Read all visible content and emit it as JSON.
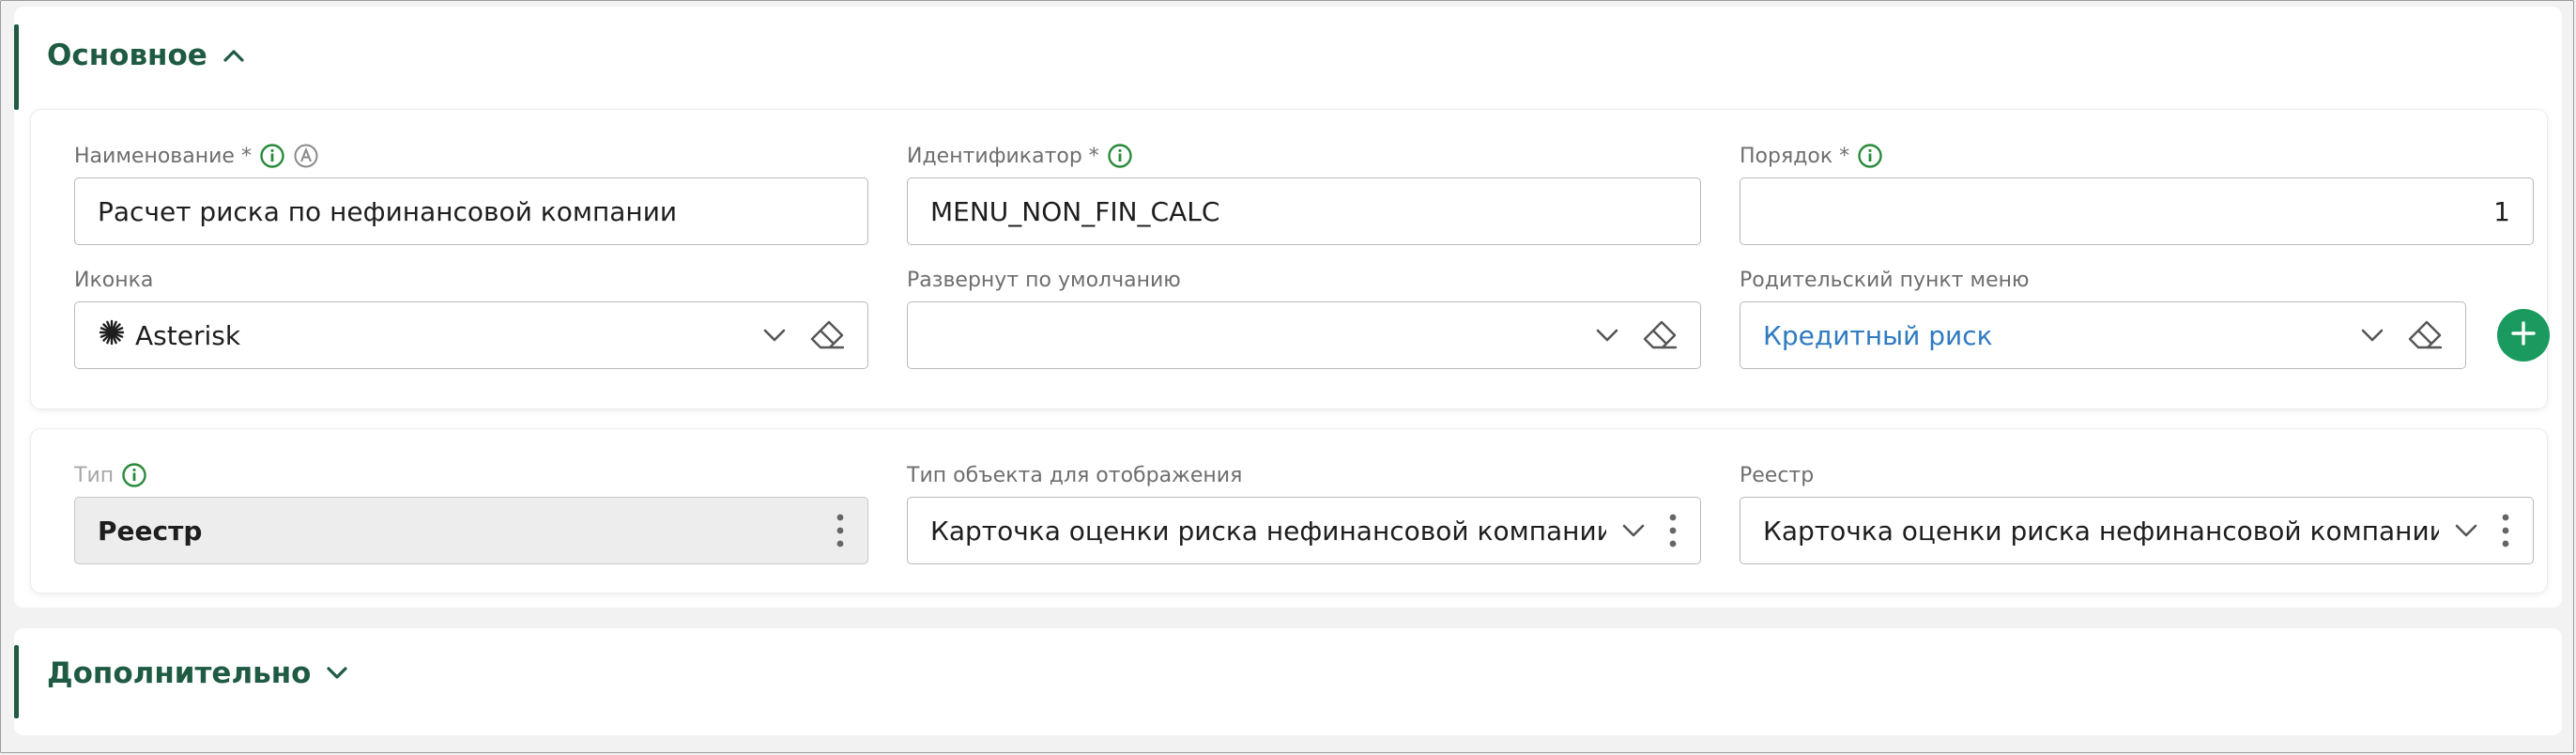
{
  "sections": {
    "main": {
      "title": "Основное"
    },
    "extra": {
      "title": "Дополнительно"
    }
  },
  "fields": {
    "name": {
      "label": "Наименование *",
      "value": "Расчет риска по нефинансовой компании"
    },
    "identifier": {
      "label": "Идентификатор *",
      "value": "MENU_NON_FIN_CALC"
    },
    "order": {
      "label": "Порядок *",
      "value": "1"
    },
    "icon": {
      "label": "Иконка",
      "value": "Asterisk"
    },
    "expanded": {
      "label": "Развернут по умолчанию",
      "value": ""
    },
    "parent": {
      "label": "Родительский пункт меню",
      "value": "Кредитный риск"
    },
    "type": {
      "label": "Тип",
      "value": "Реестр"
    },
    "object_type": {
      "label": "Тип объекта для отображения",
      "value": "Карточка оценки риска нефинансовой компании"
    },
    "registry": {
      "label": "Реестр",
      "value": "Карточка оценки риска нефинансовой компании"
    }
  },
  "colors": {
    "accent": "#1f5a43",
    "info": "#2a8a3a",
    "link": "#2f7ac0",
    "add_button": "#1a9a5e"
  },
  "icons": {
    "section_expanded": "chevron-up-icon",
    "section_collapsed": "chevron-down-icon",
    "info": "info-icon",
    "auto": "a-circle-icon",
    "clear": "eraser-icon",
    "dropdown": "chevron-down-icon",
    "more": "kebab-icon",
    "add": "plus-icon"
  }
}
